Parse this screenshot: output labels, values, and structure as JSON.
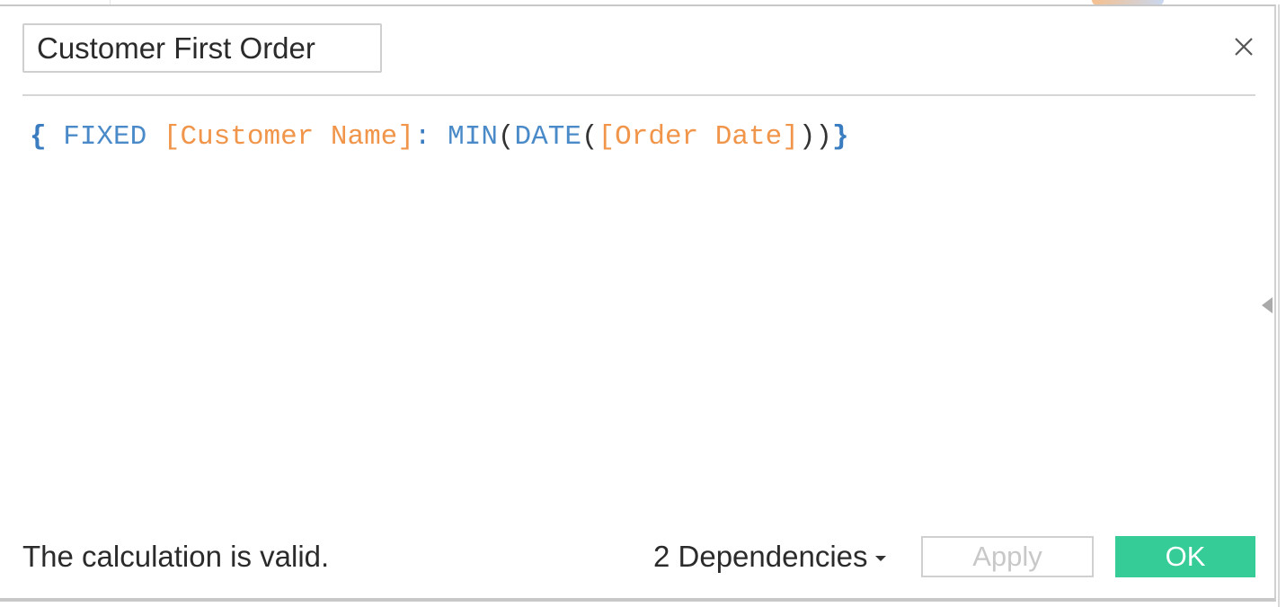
{
  "dialog": {
    "calc_name": "Customer First Order",
    "formula": {
      "open_brace": "{",
      "fixed_kw": "FIXED",
      "field1": "[Customer Name]",
      "colon": ":",
      "min_fn": "MIN",
      "open1": "(",
      "date_fn": "DATE",
      "open2": "(",
      "field2": "[Order Date]",
      "close": "))",
      "close_brace": "}"
    },
    "status": "The calculation is valid.",
    "dependencies_label": "2 Dependencies",
    "apply_label": "Apply",
    "ok_label": "OK"
  },
  "colors": {
    "ok": "#35cc98",
    "keyword": "#4a8ac8",
    "field": "#f0954a"
  }
}
